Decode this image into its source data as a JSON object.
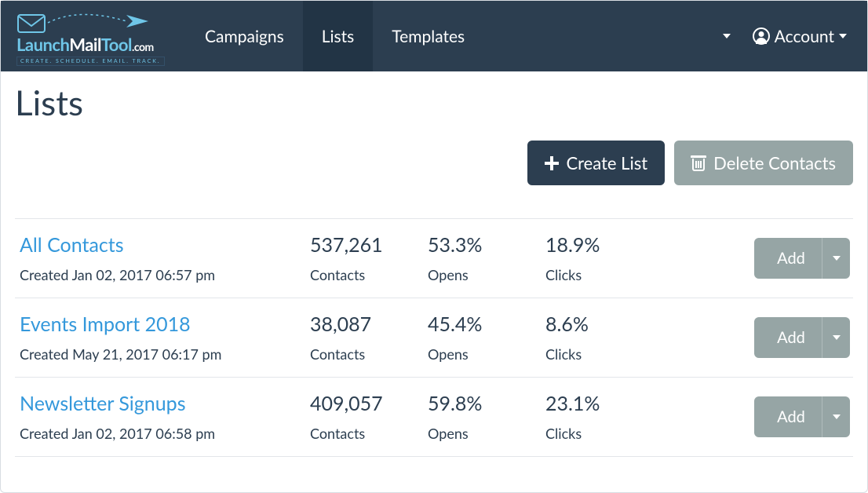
{
  "brand": {
    "name_part1": "Launch",
    "name_part2": "Mail",
    "name_part3": "Tool",
    "name_part4": ".com",
    "tagline": "CREATE. SCHEDULE. EMAIL. TRACK."
  },
  "nav": {
    "items": [
      {
        "label": "Campaigns",
        "active": false
      },
      {
        "label": "Lists",
        "active": true
      },
      {
        "label": "Templates",
        "active": false
      }
    ],
    "account_label": "Account"
  },
  "page": {
    "title": "Lists",
    "actions": {
      "create_label": "Create List",
      "delete_label": "Delete Contacts",
      "row_add_label": "Add"
    },
    "stat_labels": {
      "contacts": "Contacts",
      "opens": "Opens",
      "clicks": "Clicks"
    },
    "lists": [
      {
        "name": "All Contacts",
        "created": "Created Jan 02, 2017 06:57 pm",
        "contacts": "537,261",
        "opens": "53.3%",
        "clicks": "18.9%"
      },
      {
        "name": "Events Import 2018",
        "created": "Created May 21, 2017 06:17 pm",
        "contacts": "38,087",
        "opens": "45.4%",
        "clicks": "8.6%"
      },
      {
        "name": "Newsletter Signups",
        "created": "Created Jan 02, 2017 06:58 pm",
        "contacts": "409,057",
        "opens": "59.8%",
        "clicks": "23.1%"
      }
    ]
  }
}
